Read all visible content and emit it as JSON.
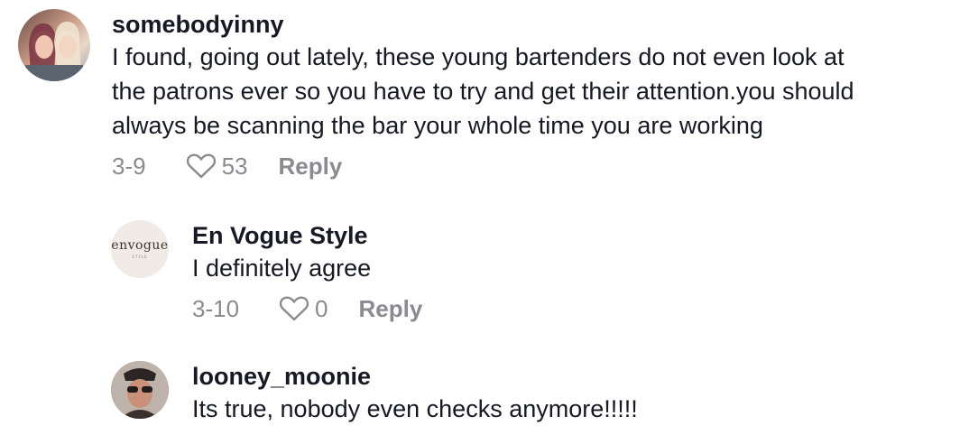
{
  "comments": [
    {
      "username": "somebodyinny",
      "lines": [
        "I found, going out lately, these young bartenders do not even look at",
        "the patrons ever so you have to try and get their attention.you should",
        "always be scanning the bar your whole time you are working"
      ],
      "date": "3-9",
      "likes": "53",
      "reply_label": "Reply",
      "avatar_icon": "photo-avatar-two-women"
    },
    {
      "username": "En Vogue Style",
      "text": "I definitely agree",
      "date": "3-10",
      "likes": "0",
      "reply_label": "Reply",
      "avatar_brand": "envogue",
      "avatar_brand_sub": "STYLE"
    },
    {
      "username": "looney_moonie",
      "text": "Its true, nobody even checks anymore!!!!!",
      "avatar_icon": "photo-avatar-woman-sunglasses"
    }
  ],
  "colors": {
    "text": "#161823",
    "muted": "#8a8b91",
    "background": "#ffffff"
  }
}
